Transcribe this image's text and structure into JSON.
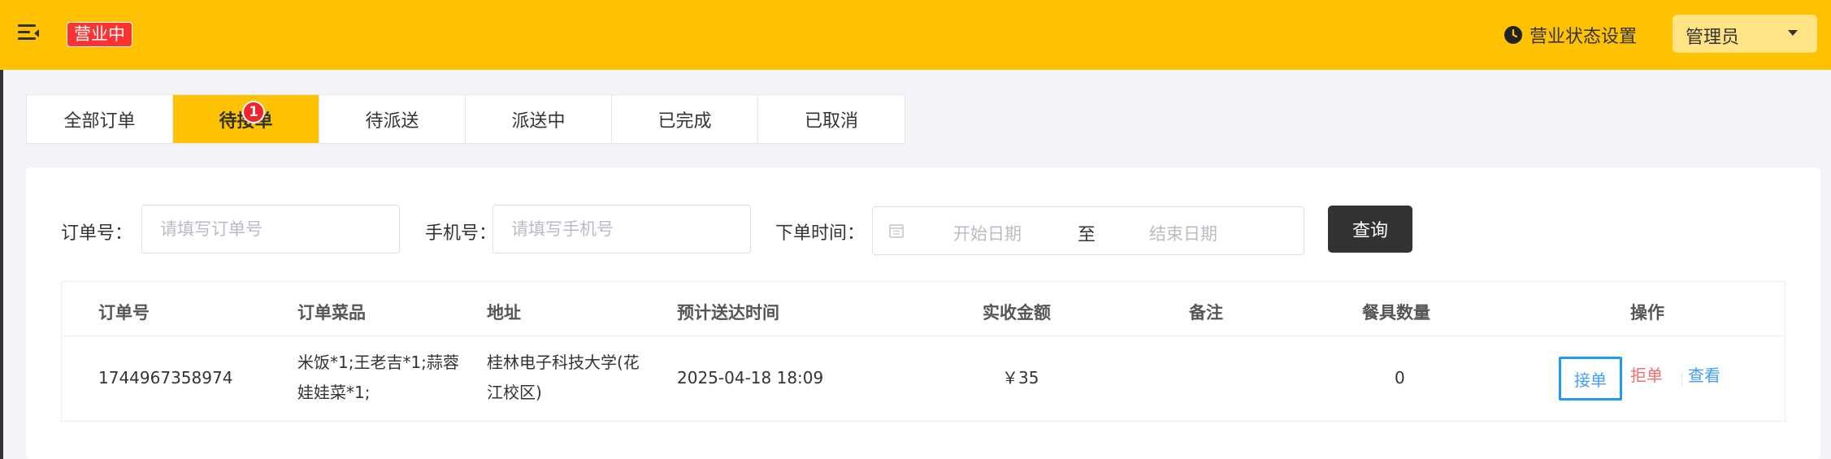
{
  "header": {
    "status_tag": "营业中",
    "business_setting": "营业状态设置",
    "admin_name": "管理员"
  },
  "tabs": [
    {
      "label": "全部订单",
      "active": false
    },
    {
      "label": "待接单",
      "active": true,
      "badge": "1"
    },
    {
      "label": "待派送",
      "active": false
    },
    {
      "label": "派送中",
      "active": false
    },
    {
      "label": "已完成",
      "active": false
    },
    {
      "label": "已取消",
      "active": false
    }
  ],
  "filters": {
    "order_no_label": "订单号：",
    "order_no_placeholder": "请填写订单号",
    "phone_label": "手机号：",
    "phone_placeholder": "请填写手机号",
    "time_label": "下单时间：",
    "start_placeholder": "开始日期",
    "separator": "至",
    "end_placeholder": "结束日期",
    "query_button": "查询"
  },
  "table": {
    "headers": [
      "订单号",
      "订单菜品",
      "地址",
      "预计送达时间",
      "实收金额",
      "备注",
      "餐具数量",
      "操作"
    ],
    "rows": [
      {
        "order_no": "1744967358974",
        "dishes_line1": "米饭*1;王老吉*1;蒜蓉",
        "dishes_line2": "娃娃菜*1;",
        "address_line1": "桂林电子科技大学(花",
        "address_line2": "江校区)",
        "eta": "2025-04-18 18:09",
        "amount": "￥35",
        "remark": "",
        "tableware": "0",
        "actions": {
          "accept": "接单",
          "reject": "拒单",
          "view": "查看"
        }
      }
    ]
  },
  "colors": {
    "brand_yellow": "#ffc200",
    "status_red": "#fd3333",
    "link_blue": "#419eff",
    "reject_red": "#f56c6c"
  }
}
